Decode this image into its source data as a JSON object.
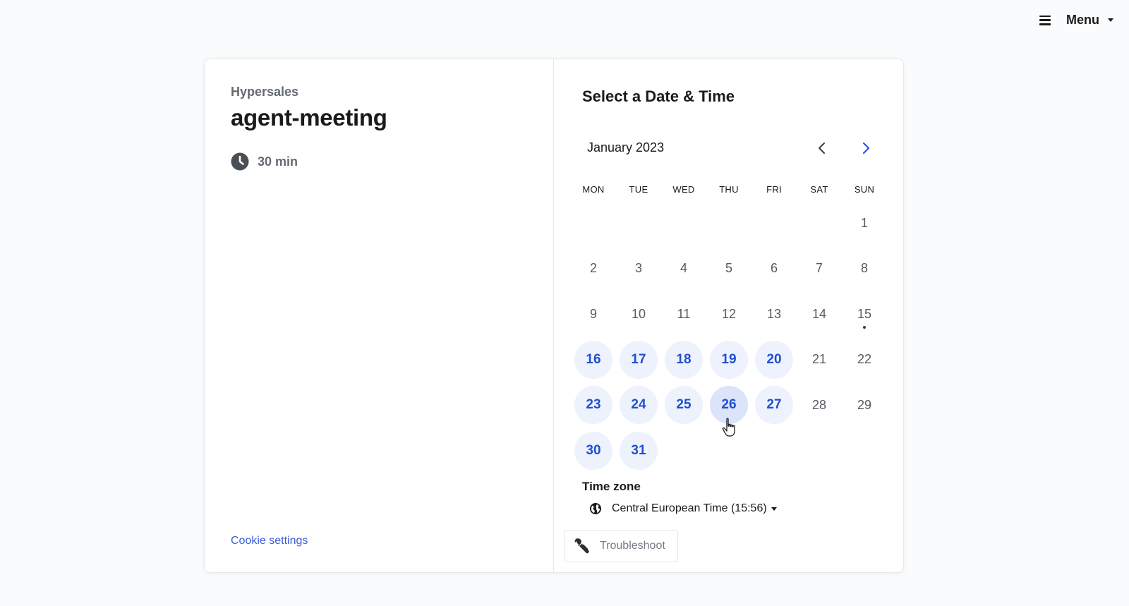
{
  "header": {
    "menu_label": "Menu"
  },
  "event": {
    "organization": "Hypersales",
    "name": "agent-meeting",
    "duration": "30 min"
  },
  "footer": {
    "cookie_settings": "Cookie settings"
  },
  "scheduler": {
    "title": "Select a Date & Time",
    "month_label": "January 2023",
    "weekdays": [
      "MON",
      "TUE",
      "WED",
      "THU",
      "FRI",
      "SAT",
      "SUN"
    ],
    "leading_blank_days": 6,
    "days": [
      {
        "num": "1",
        "available": false
      },
      {
        "num": "2",
        "available": false
      },
      {
        "num": "3",
        "available": false
      },
      {
        "num": "4",
        "available": false
      },
      {
        "num": "5",
        "available": false
      },
      {
        "num": "6",
        "available": false
      },
      {
        "num": "7",
        "available": false
      },
      {
        "num": "8",
        "available": false
      },
      {
        "num": "9",
        "available": false
      },
      {
        "num": "10",
        "available": false
      },
      {
        "num": "11",
        "available": false
      },
      {
        "num": "12",
        "available": false
      },
      {
        "num": "13",
        "available": false
      },
      {
        "num": "14",
        "available": false
      },
      {
        "num": "15",
        "available": false,
        "today": true
      },
      {
        "num": "16",
        "available": true
      },
      {
        "num": "17",
        "available": true
      },
      {
        "num": "18",
        "available": true
      },
      {
        "num": "19",
        "available": true
      },
      {
        "num": "20",
        "available": true
      },
      {
        "num": "21",
        "available": false
      },
      {
        "num": "22",
        "available": false
      },
      {
        "num": "23",
        "available": true
      },
      {
        "num": "24",
        "available": true
      },
      {
        "num": "25",
        "available": true
      },
      {
        "num": "26",
        "available": true,
        "hovered": true
      },
      {
        "num": "27",
        "available": true
      },
      {
        "num": "28",
        "available": false
      },
      {
        "num": "29",
        "available": false
      },
      {
        "num": "30",
        "available": true
      },
      {
        "num": "31",
        "available": true
      }
    ],
    "timezone_title": "Time zone",
    "timezone_value": "Central European Time (15:56)",
    "troubleshoot_label": "Troubleshoot"
  },
  "colors": {
    "accent": "#1f4fd1",
    "available_bg": "#eef2fd",
    "link": "#3a5cdb"
  }
}
